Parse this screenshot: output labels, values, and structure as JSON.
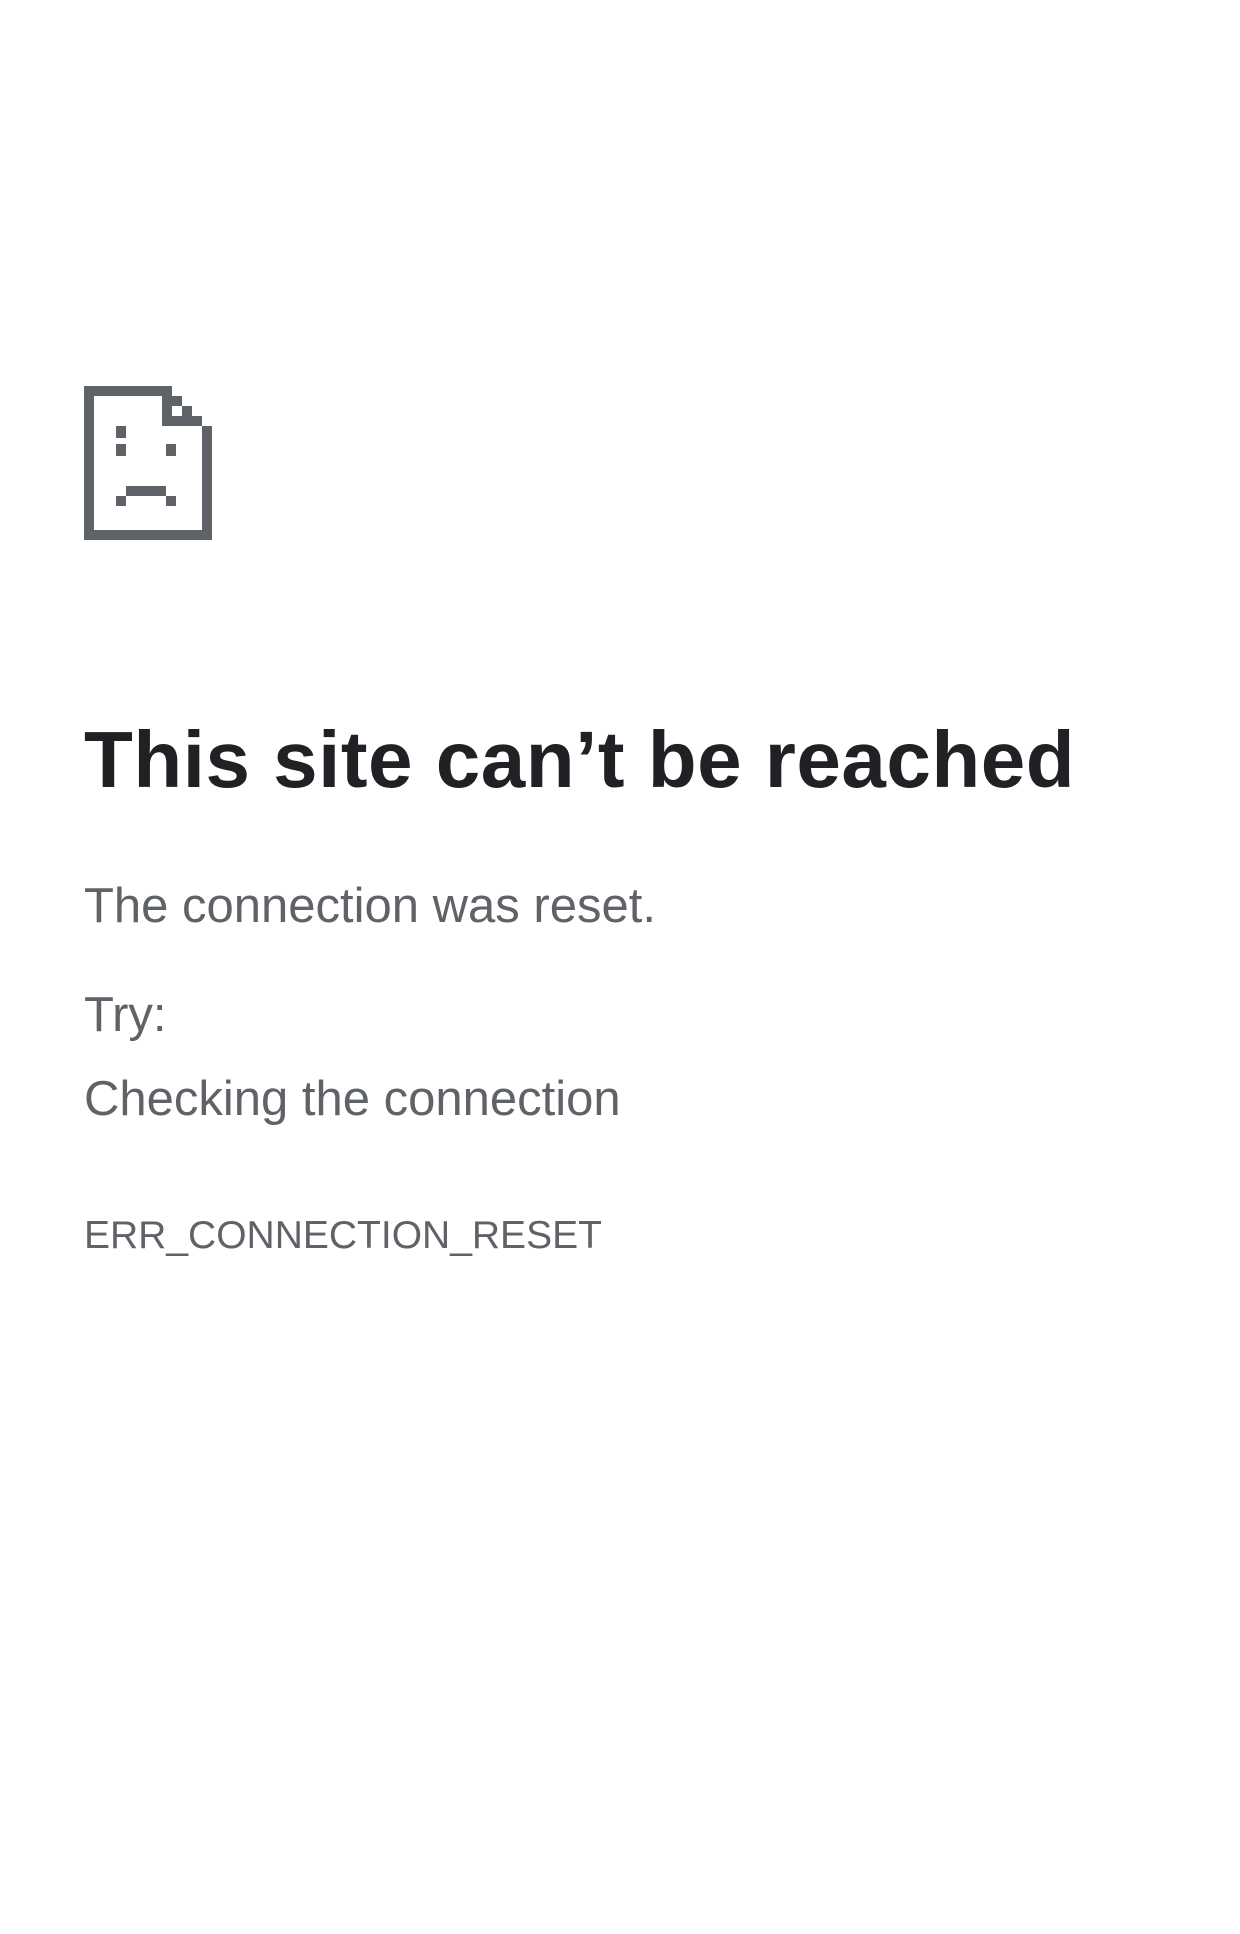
{
  "error": {
    "icon": "sad-page-icon",
    "icon_color": "#5f6368",
    "title": "This site can’t be reached",
    "summary": "The connection was reset.",
    "try_label": "Try:",
    "suggestions": [
      "Checking the connection"
    ],
    "code": "ERR_CONNECTION_RESET"
  },
  "colors": {
    "background": "#ffffff",
    "heading": "#202124",
    "body_text": "#5f6368"
  }
}
